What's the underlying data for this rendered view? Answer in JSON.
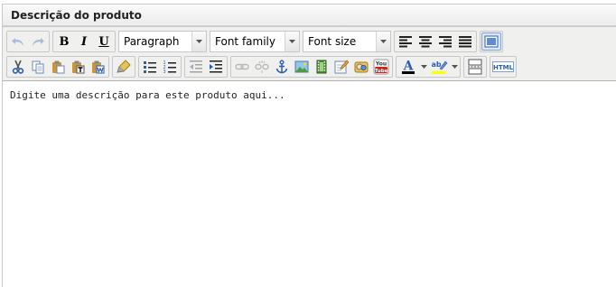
{
  "panel": {
    "title": "Descrição do produto"
  },
  "toolbar": {
    "bold_label": "B",
    "italic_label": "I",
    "underline_label": "U",
    "format_select": {
      "value": "Paragraph"
    },
    "font_family_select": {
      "value": "Font family"
    },
    "font_size_select": {
      "value": "Font size"
    },
    "html_label": "HTML",
    "youtube_label": "You Tube",
    "spellcheck_label": "ab"
  },
  "editor": {
    "content_text": "Digite uma descrição para este produto aqui..."
  },
  "colors": {
    "toolbar_bg": "#f0f0ee",
    "icon_blue": "#2a5db0",
    "text_color_swatch": "#000000",
    "highlight_swatch": "#ffff00"
  }
}
